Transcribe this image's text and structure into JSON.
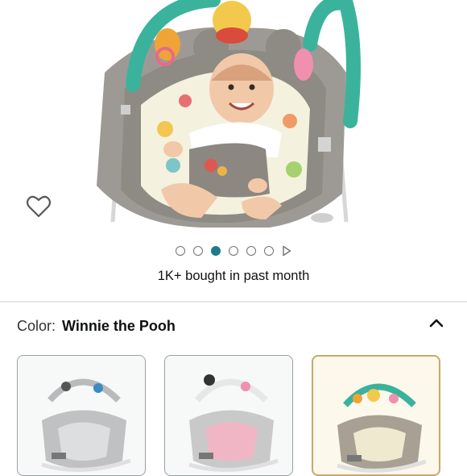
{
  "hero": {
    "image": "infant-bouncer-winnie-the-pooh-with-baby",
    "wishlist_icon": "heart-outline-icon"
  },
  "carousel": {
    "dots": [
      {
        "active": false
      },
      {
        "active": false
      },
      {
        "active": true
      },
      {
        "active": false
      },
      {
        "active": false
      },
      {
        "active": false
      }
    ],
    "play_icon": "play-icon",
    "bought_text": "1K+ bought in past month"
  },
  "variant": {
    "label": "Color:",
    "selected": "Winnie the Pooh",
    "collapse_icon": "chevron-up-icon",
    "swatches": [
      {
        "name": "gray-mickey-bouncer",
        "selected": false,
        "color": "#bfc1c3"
      },
      {
        "name": "pink-minnie-bouncer",
        "selected": false,
        "color": "#f1b6c6"
      },
      {
        "name": "winnie-the-pooh-bouncer",
        "selected": true,
        "color": "#a9a094"
      }
    ]
  },
  "colors": {
    "accent_dot": "#1f7a8c",
    "selected_border": "#c8a86b"
  }
}
